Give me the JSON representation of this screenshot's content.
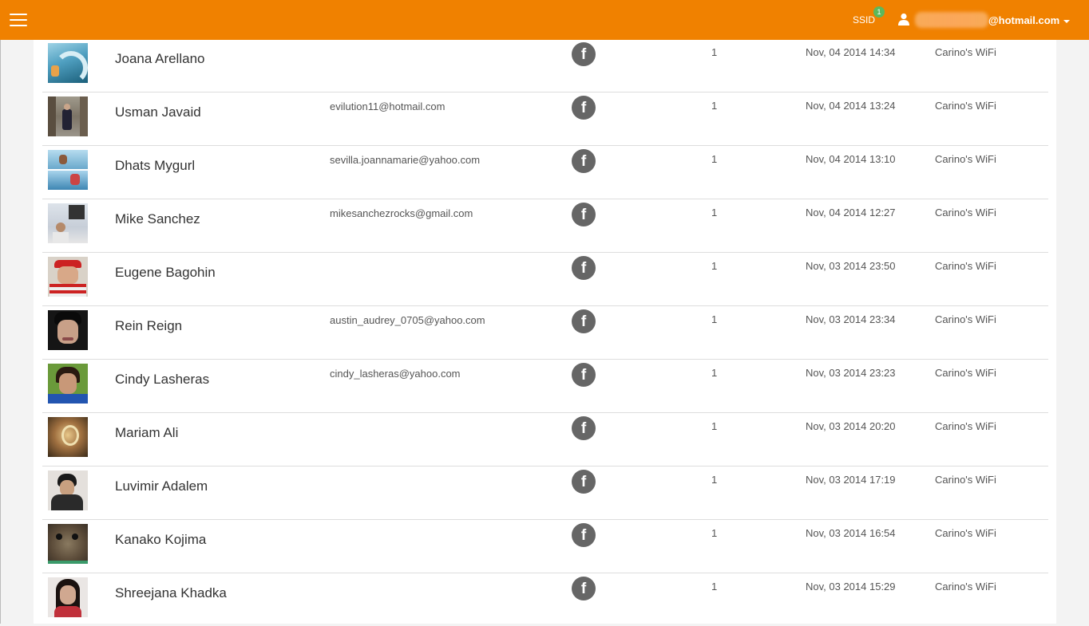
{
  "header": {
    "ssid_label": "SSID",
    "ssid_badge": "1",
    "user_email": "@hotmail.com",
    "bar_color": "#f08100"
  },
  "icons": {
    "menu": "hamburger-menu-icon",
    "user": "user-icon",
    "dropdown": "caret-down-icon",
    "social": "facebook-icon"
  },
  "rows": [
    {
      "name": "Joana Arellano",
      "email": "",
      "visits": "1",
      "date": "Nov, 04 2014 14:34",
      "ssid": "Carino's WiFi"
    },
    {
      "name": "Usman Javaid",
      "email": "evilution11@hotmail.com",
      "visits": "1",
      "date": "Nov, 04 2014 13:24",
      "ssid": "Carino's WiFi"
    },
    {
      "name": "Dhats Mygurl",
      "email": "sevilla.joannamarie@yahoo.com",
      "visits": "1",
      "date": "Nov, 04 2014 13:10",
      "ssid": "Carino's WiFi"
    },
    {
      "name": "Mike Sanchez",
      "email": "mikesanchezrocks@gmail.com",
      "visits": "1",
      "date": "Nov, 04 2014 12:27",
      "ssid": "Carino's WiFi"
    },
    {
      "name": "Eugene Bagohin",
      "email": "",
      "visits": "1",
      "date": "Nov, 03 2014 23:50",
      "ssid": "Carino's WiFi"
    },
    {
      "name": "Rein Reign",
      "email": "austin_audrey_0705@yahoo.com",
      "visits": "1",
      "date": "Nov, 03 2014 23:34",
      "ssid": "Carino's WiFi"
    },
    {
      "name": "Cindy Lasheras",
      "email": "cindy_lasheras@yahoo.com",
      "visits": "1",
      "date": "Nov, 03 2014 23:23",
      "ssid": "Carino's WiFi"
    },
    {
      "name": "Mariam Ali",
      "email": "",
      "visits": "1",
      "date": "Nov, 03 2014 20:20",
      "ssid": "Carino's WiFi"
    },
    {
      "name": "Luvimir Adalem",
      "email": "",
      "visits": "1",
      "date": "Nov, 03 2014 17:19",
      "ssid": "Carino's WiFi"
    },
    {
      "name": "Kanako Kojima",
      "email": "",
      "visits": "1",
      "date": "Nov, 03 2014 16:54",
      "ssid": "Carino's WiFi"
    },
    {
      "name": "Shreejana Khadka",
      "email": "",
      "visits": "1",
      "date": "Nov, 03 2014 15:29",
      "ssid": "Carino's WiFi"
    }
  ]
}
